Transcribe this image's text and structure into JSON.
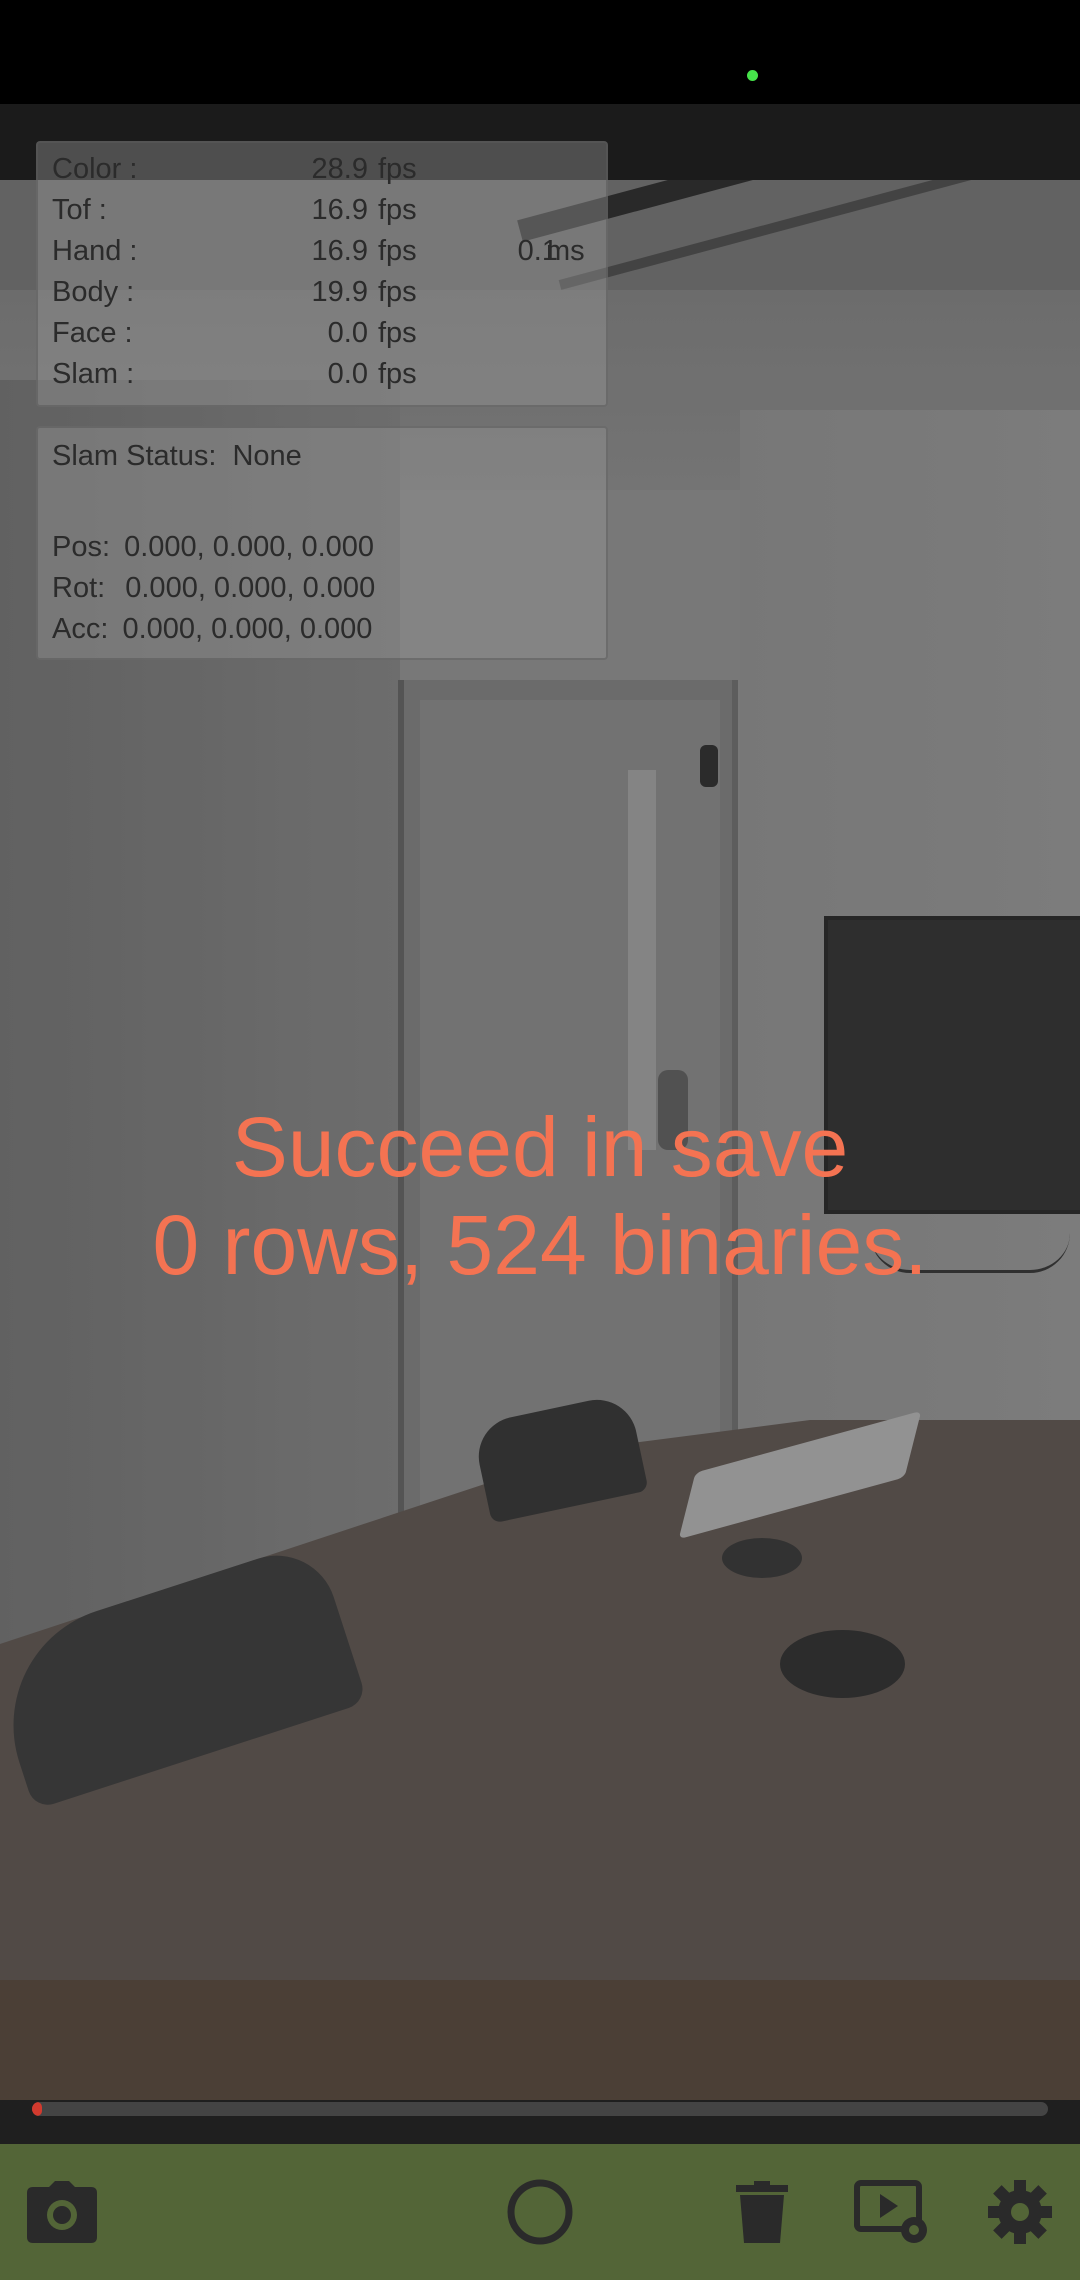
{
  "fps_panel": {
    "rows": [
      {
        "label": "Color :",
        "value": "28.9",
        "unit": "fps"
      },
      {
        "label": "Tof :",
        "value": "16.9",
        "unit": "fps"
      },
      {
        "label": "Hand :",
        "value": "16.9",
        "unit": "fps",
        "extra_value": "0.1",
        "extra_unit": "ms"
      },
      {
        "label": "Body :",
        "value": "19.9",
        "unit": "fps"
      },
      {
        "label": "Face :",
        "value": "0.0",
        "unit": "fps"
      },
      {
        "label": "Slam :",
        "value": "0.0",
        "unit": "fps"
      }
    ]
  },
  "slam_panel": {
    "status_label": "Slam Status:",
    "status_value": "None",
    "pos_label": "Pos:",
    "pos_value": "0.000, 0.000, 0.000",
    "rot_label": "Rot:",
    "rot_value": "0.000, 0.000, 0.000",
    "acc_label": "Acc:",
    "acc_value": "0.000, 0.000, 0.000"
  },
  "toast": {
    "line1": "Succeed in save",
    "line2": "0 rows, 524 binaries."
  },
  "progress": {
    "fraction": 0.01
  },
  "colors": {
    "toast": "#f47352",
    "bottom_bar": "#536537",
    "progress_fill": "#d23a2e",
    "camera_indicator": "#46e24a"
  },
  "toolbar": {
    "icons": [
      "camera-icon",
      "record-icon",
      "trash-icon",
      "playback-settings-icon",
      "settings-gear-icon"
    ]
  }
}
